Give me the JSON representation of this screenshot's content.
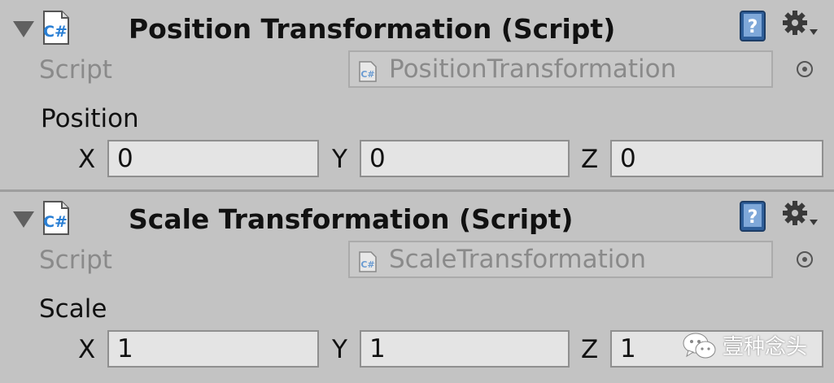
{
  "components": [
    {
      "title": "Position Transformation (Script)",
      "script_label": "Script",
      "script_value": "PositionTransformation",
      "property_label": "Position",
      "fields": [
        {
          "axis": "X",
          "value": "0"
        },
        {
          "axis": "Y",
          "value": "0"
        },
        {
          "axis": "Z",
          "value": "0"
        }
      ]
    },
    {
      "title": "Scale Transformation (Script)",
      "script_label": "Script",
      "script_value": "ScaleTransformation",
      "property_label": "Scale",
      "fields": [
        {
          "axis": "X",
          "value": "1"
        },
        {
          "axis": "Y",
          "value": "1"
        },
        {
          "axis": "Z",
          "value": "1"
        }
      ]
    }
  ],
  "icons": {
    "foldout": "foldout-arrow-icon",
    "script": "csharp-script-icon",
    "help": "help-book-icon",
    "settings": "gear-dropdown-icon",
    "picker": "object-picker-icon",
    "watermark": "wechat-icon"
  },
  "watermark": {
    "text": "壹种念头"
  },
  "colors": {
    "background": "#c3c3c3",
    "script_icon_accent": "#2a7fd4",
    "help_icon": "#2f5f9a"
  }
}
